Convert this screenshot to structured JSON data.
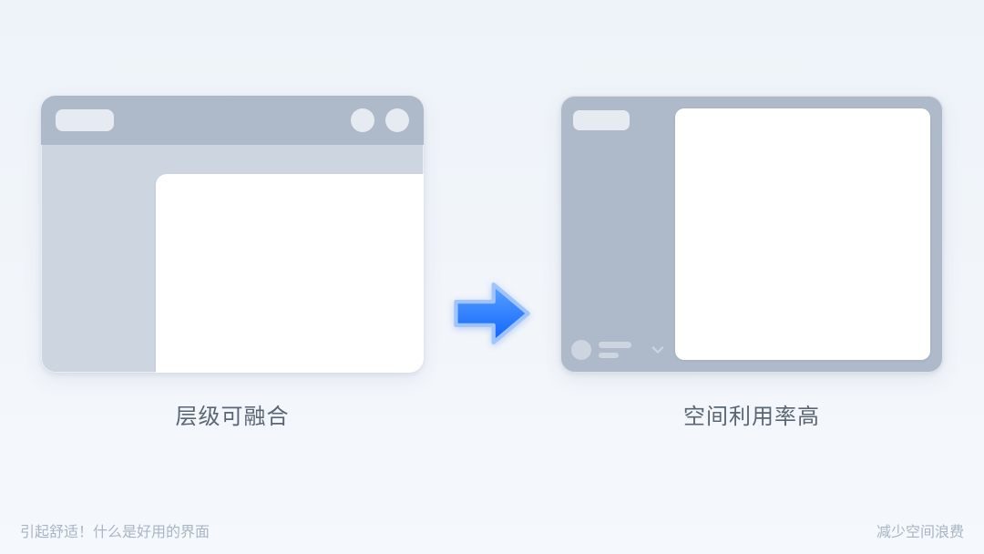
{
  "left_caption": "层级可融合",
  "right_caption": "空间利用率高",
  "footer_left": "引起舒适！什么是好用的界面",
  "footer_right": "减少空间浪费"
}
